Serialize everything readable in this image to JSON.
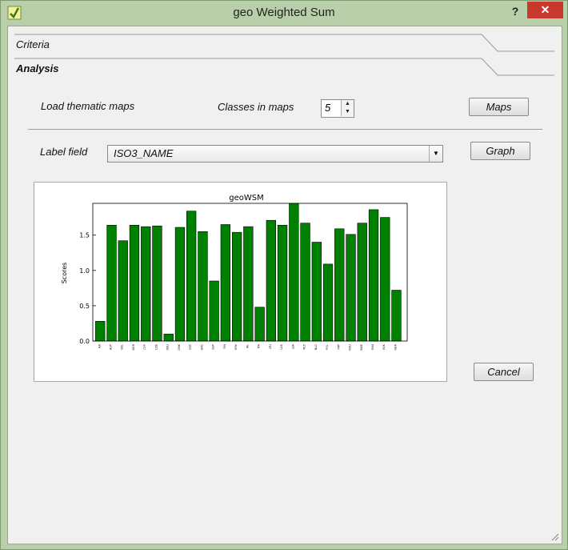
{
  "window": {
    "title": "geo Weighted Sum",
    "help": "?",
    "close": "✕"
  },
  "tabs": {
    "criteria": "Criteria",
    "analysis": "Analysis"
  },
  "analysis": {
    "load_label": "Load thematic maps",
    "classes_label": "Classes in maps",
    "classes_value": "5",
    "maps_button": "Maps",
    "label_field_label": "Label field",
    "label_field_value": "ISO3_NAME",
    "graph_button": "Graph",
    "cancel_button": "Cancel"
  },
  "icons": {
    "app": "qgis-plugin-icon",
    "spin_up": "arrow-up-icon",
    "spin_down": "arrow-down-icon",
    "combo": "chevron-down-icon"
  },
  "colors": {
    "bar": "#008000",
    "close": "#c7392c",
    "titlebar": "#b9cfa9"
  },
  "chart_data": {
    "type": "bar",
    "title": "geoWSM",
    "xlabel": "",
    "ylabel": "Scores",
    "ylim": [
      0,
      1.95
    ],
    "yticks": [
      "0.0",
      "0.5",
      "1.0",
      "1.5"
    ],
    "categories": [
      "AA",
      "AUT",
      "BEL",
      "BGR",
      "CYP",
      "CZE",
      "DEU",
      "DNK",
      "EST",
      "GRC",
      "ESP",
      "FIN",
      "HRV",
      "IRL",
      "ITA",
      "LTU",
      "LUX",
      "LVA",
      "MLT",
      "NLD",
      "POL",
      "PRT",
      "ROU",
      "SWE",
      "SVN",
      "SVK",
      "GBR"
    ],
    "values": [
      0.28,
      1.64,
      1.42,
      1.64,
      1.62,
      1.63,
      0.1,
      1.61,
      1.84,
      1.55,
      0.85,
      1.65,
      1.54,
      1.62,
      0.48,
      1.71,
      1.64,
      1.95,
      1.67,
      1.4,
      1.09,
      1.59,
      1.51,
      1.67,
      1.86,
      1.75,
      0.72
    ]
  }
}
